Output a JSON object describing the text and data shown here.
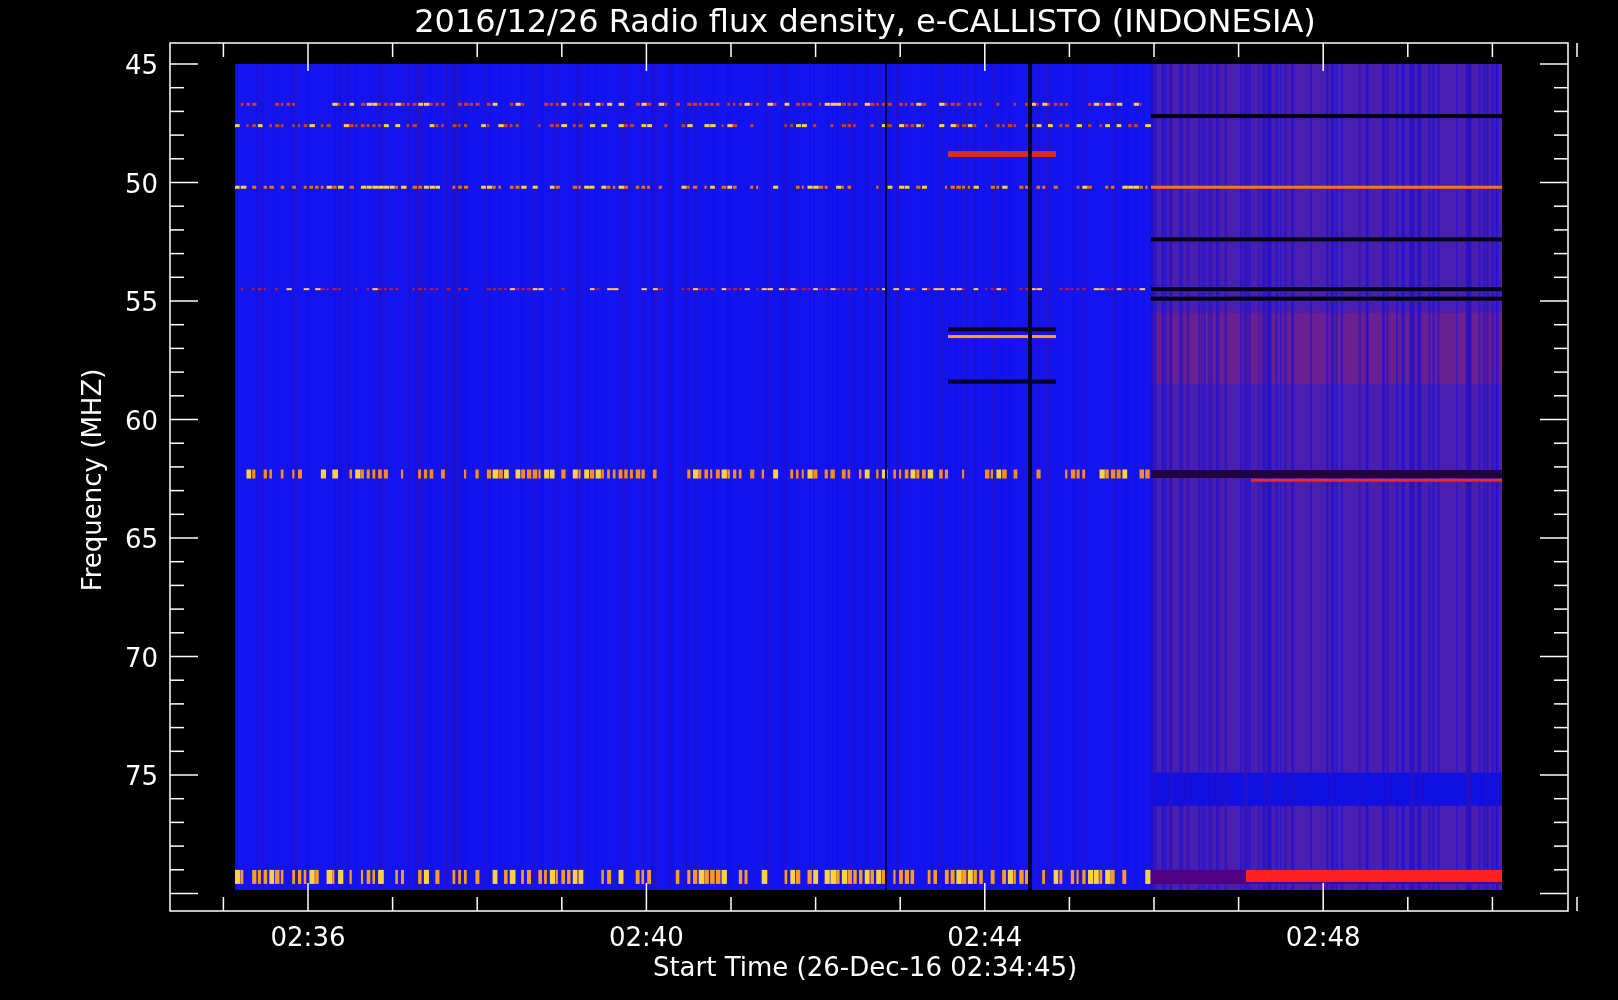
{
  "title": "2016/12/26  Radio flux density, e-CALLISTO (INDONESIA)",
  "y_axis": {
    "label": "Frequency (MHZ)",
    "ticks": [
      "45",
      "50",
      "55",
      "60",
      "65",
      "70",
      "75"
    ]
  },
  "x_axis": {
    "label": "Start Time (26-Dec-16 02:34:45)",
    "ticks": [
      "02:36",
      "02:40",
      "02:44",
      "02:48"
    ]
  }
}
